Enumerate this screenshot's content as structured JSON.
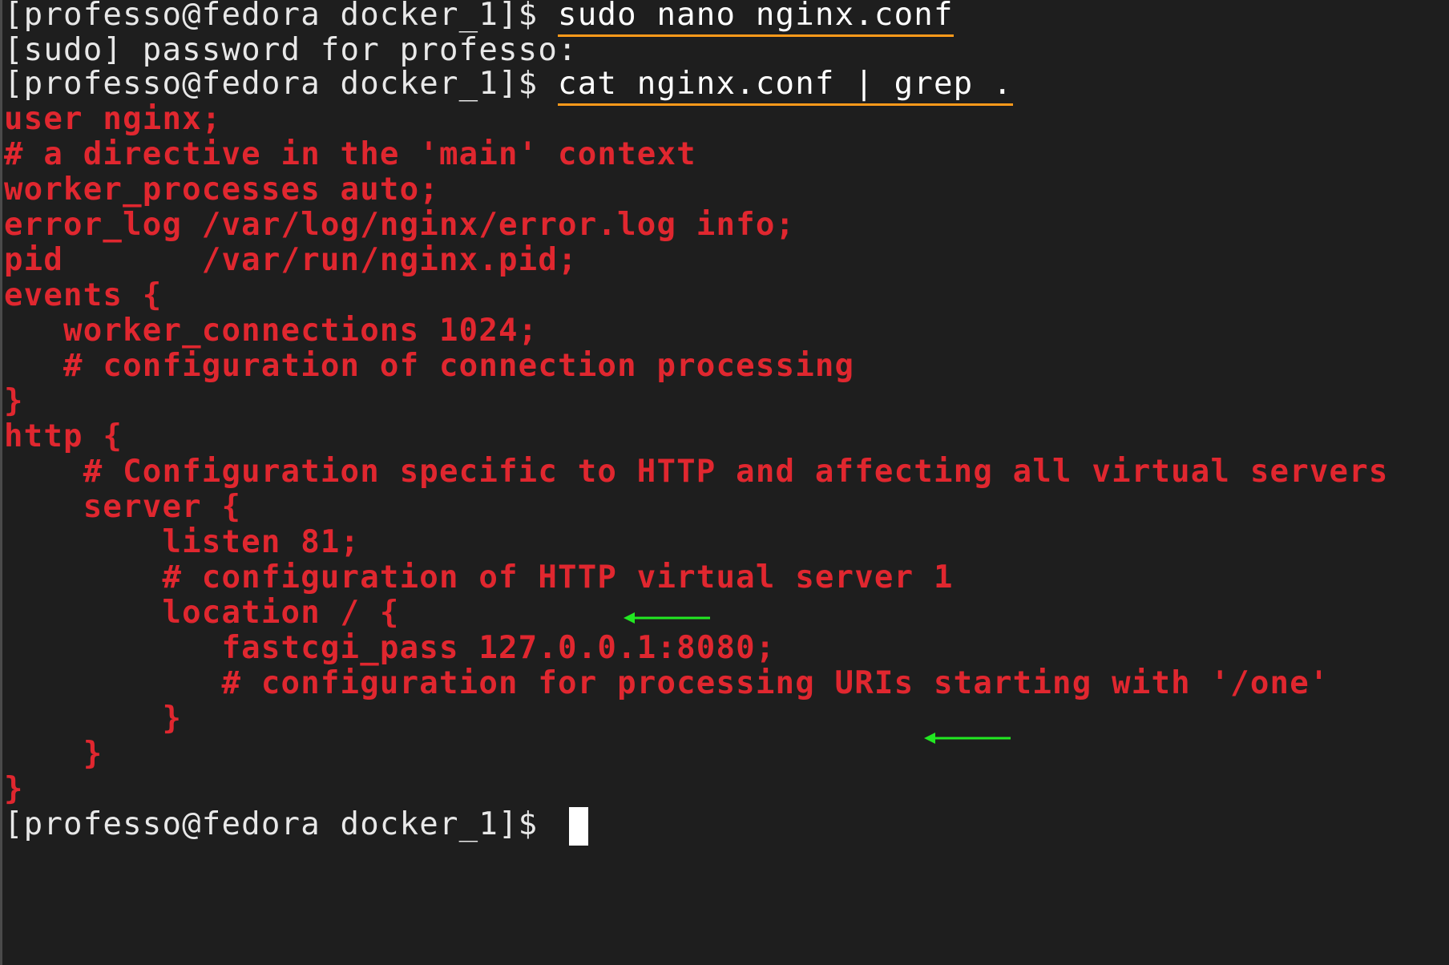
{
  "terminal": {
    "lines": [
      {
        "prompt": "[professo@fedora docker_1]$ ",
        "command": "sudo nano nginx.conf"
      },
      {
        "text": "[sudo] password for professo:"
      },
      {
        "prompt": "[professo@fedora docker_1]$ ",
        "command": "cat nginx.conf | grep ."
      }
    ],
    "config_lines": [
      "user nginx;",
      "# a directive in the 'main' context",
      "worker_processes auto;",
      "error_log /var/log/nginx/error.log info;",
      "pid       /var/run/nginx.pid;",
      "events {",
      "   worker_connections 1024;",
      "   # configuration of connection processing",
      "}",
      "http {",
      "    # Configuration specific to HTTP and affecting all virtual servers",
      "    server {",
      "        listen 81;",
      "        # configuration of HTTP virtual server 1",
      "        location / {",
      "           fastcgi_pass 127.0.0.1:8080;",
      "           # configuration for processing URIs starting with '/one'",
      "        }",
      "    }",
      "}"
    ],
    "final_prompt": "[professo@fedora docker_1]$ ",
    "colors": {
      "background": "#1e1e1e",
      "config_text": "#e0272f",
      "underline": "#ff9a1a",
      "arrow": "#22e822"
    },
    "annotations": [
      "arrow-icon",
      "arrow-icon"
    ]
  }
}
